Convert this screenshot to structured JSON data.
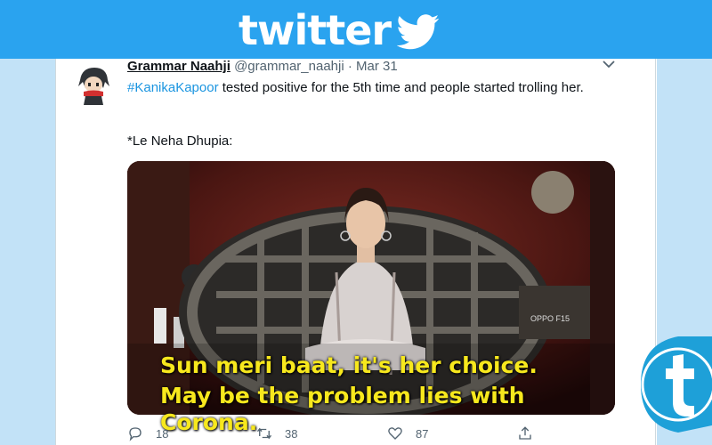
{
  "banner": {
    "title": "twitter"
  },
  "tweet": {
    "author_name": "Grammar Naahji",
    "handle": "@grammar_naahji",
    "separator": "·",
    "date": "Mar 31",
    "hashtag": "#KanikaKapoor",
    "text_rest": " tested positive for the 5th time and people started trolling her.",
    "text_line2": "*Le Neha Dhupia:"
  },
  "media": {
    "subtitle_line1": "Sun meri baat, it's her choice.",
    "subtitle_line2": "May be the problem lies with Corona.",
    "overlay_label": "OPPO F15"
  },
  "actions": {
    "reply_count": "18",
    "retweet_count": "38",
    "like_count": "87"
  },
  "colors": {
    "banner": "#2aa3ef",
    "side_panel": "#c2e2f7",
    "hashtag": "#1b95e0",
    "subtitle": "#f7e81d"
  },
  "icons": [
    "twitter-bird-icon",
    "chevron-down-icon",
    "reply-icon",
    "retweet-icon",
    "heart-icon",
    "share-icon",
    "t-logo-icon"
  ]
}
